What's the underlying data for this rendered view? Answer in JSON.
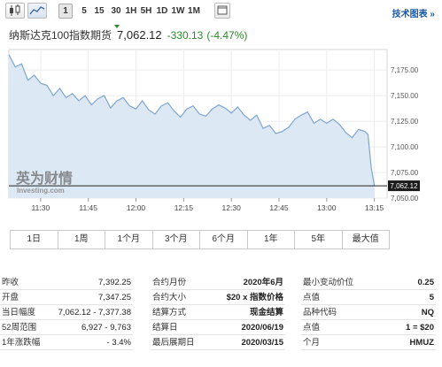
{
  "toolbar": {
    "periods": [
      "1",
      "5",
      "15",
      "30",
      "1H",
      "5H",
      "1D",
      "1W",
      "1M"
    ],
    "active_period": "1",
    "tech_chart_link": "技术图表 »"
  },
  "instrument": {
    "name": "纳斯达克100指数期货",
    "price": "7,062.12",
    "change": "-330.13",
    "change_pct": "(-4.47%)",
    "change_color": "#2a8a2a"
  },
  "watermark": {
    "brand_cn": "英为财情",
    "brand_en": "Investing.com"
  },
  "chart_data": {
    "type": "area",
    "x_tick_labels": [
      "11:30",
      "11:45",
      "12:00",
      "12:15",
      "12:30",
      "12:45",
      "13:00",
      "13:15"
    ],
    "y_tick_labels": [
      "7,175.00",
      "7,150.00",
      "7,125.00",
      "7,100.00",
      "7,075.00",
      "7,050.00"
    ],
    "ylim": [
      7050,
      7195
    ],
    "last_price_label": "7,062.12",
    "x": [
      "11:20",
      "11:22",
      "11:24",
      "11:26",
      "11:28",
      "11:30",
      "11:32",
      "11:34",
      "11:36",
      "11:38",
      "11:40",
      "11:42",
      "11:44",
      "11:46",
      "11:48",
      "11:50",
      "11:52",
      "11:54",
      "11:56",
      "11:58",
      "12:00",
      "12:02",
      "12:04",
      "12:06",
      "12:08",
      "12:10",
      "12:12",
      "12:14",
      "12:16",
      "12:18",
      "12:20",
      "12:22",
      "12:24",
      "12:26",
      "12:28",
      "12:30",
      "12:32",
      "12:34",
      "12:36",
      "12:38",
      "12:40",
      "12:42",
      "12:44",
      "12:46",
      "12:48",
      "12:50",
      "12:52",
      "12:54",
      "12:56",
      "12:58",
      "13:00",
      "13:02",
      "13:04",
      "13:06",
      "13:08",
      "13:10",
      "13:12",
      "13:13",
      "13:14",
      "13:15"
    ],
    "y": [
      7190,
      7178,
      7181,
      7165,
      7170,
      7162,
      7160,
      7150,
      7157,
      7148,
      7152,
      7145,
      7150,
      7141,
      7147,
      7150,
      7138,
      7145,
      7148,
      7140,
      7137,
      7145,
      7136,
      7132,
      7140,
      7143,
      7135,
      7129,
      7137,
      7140,
      7132,
      7130,
      7137,
      7141,
      7138,
      7133,
      7139,
      7131,
      7126,
      7131,
      7118,
      7121,
      7113,
      7115,
      7119,
      7127,
      7131,
      7134,
      7123,
      7127,
      7123,
      7127,
      7122,
      7114,
      7109,
      7117,
      7115,
      7112,
      7080,
      7062
    ],
    "line_color": "#7fa6cf",
    "fill_color": "#dde8f5",
    "grid": true
  },
  "ranges": [
    "1日",
    "1周",
    "1个月",
    "3个月",
    "6个月",
    "1年",
    "5年",
    "最大值"
  ],
  "info_rows": [
    [
      {
        "k": "昨收",
        "v": "7,392.25",
        "bold": false
      },
      {
        "k": "合约月份",
        "v": "2020年6月",
        "bold": true
      },
      {
        "k": "最小变动价位",
        "v": "0.25",
        "bold": true
      }
    ],
    [
      {
        "k": "开盘",
        "v": "7,347.25",
        "bold": false
      },
      {
        "k": "合约大小",
        "v": "$20 x 指数价格",
        "bold": true
      },
      {
        "k": "点值",
        "v": "5",
        "bold": true
      }
    ],
    [
      {
        "k": "当日幅度",
        "v": "7,062.12 - 7,377.38",
        "bold": false
      },
      {
        "k": "结算方式",
        "v": "现金结算",
        "bold": true
      },
      {
        "k": "品种代码",
        "v": "NQ",
        "bold": true
      }
    ],
    [
      {
        "k": "52周范围",
        "v": "6,927 - 9,763",
        "bold": false
      },
      {
        "k": "结算日",
        "v": "2020/06/19",
        "bold": true
      },
      {
        "k": "点值",
        "v": "1 = $20",
        "bold": true
      }
    ],
    [
      {
        "k": "1年涨跌幅",
        "v": "- 3.4%",
        "bold": false
      },
      {
        "k": "最后展期日",
        "v": "2020/03/15",
        "bold": true
      },
      {
        "k": "个月",
        "v": "HMUZ",
        "bold": true
      }
    ]
  ]
}
